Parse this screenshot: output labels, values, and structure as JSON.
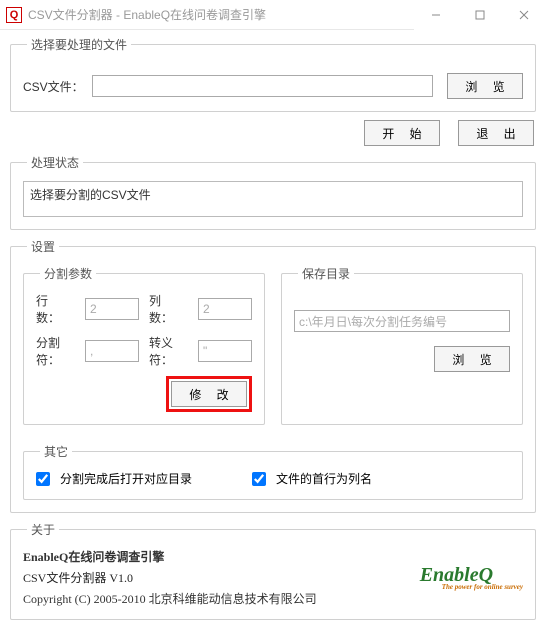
{
  "titlebar": {
    "title": "CSV文件分割器 - EnableQ在线问卷调查引擎"
  },
  "groups": {
    "select_file": "选择要处理的文件",
    "status": "处理状态",
    "settings": "设置",
    "split_params": "分割参数",
    "save_dir": "保存目录",
    "other": "其它",
    "about": "关于"
  },
  "labels": {
    "csv_file": "CSV文件：",
    "rows": "行数：",
    "cols": "列数：",
    "delimiter": "分割符：",
    "escape": "转义符："
  },
  "buttons": {
    "browse": "浏 览",
    "start": "开 始",
    "exit": "退 出",
    "modify": "修 改"
  },
  "values": {
    "csv_path": "",
    "status_text": "选择要分割的CSV文件",
    "rows": "2",
    "cols": "2",
    "delimiter": ",",
    "escape": "\"",
    "save_dir_hint": "c:\\年月日\\每次分割任务编号"
  },
  "checkboxes": {
    "open_dir_after": "分割完成后打开对应目录",
    "first_line_header": "文件的首行为列名"
  },
  "about": {
    "title": "EnableQ在线问卷调查引擎",
    "sub": "CSV文件分割器  V1.0",
    "copy": "Copyright (C) 2005-2010 北京科维能动信息技术有限公司",
    "logo_main": "EnableQ",
    "logo_tag": "The power for online survey"
  }
}
